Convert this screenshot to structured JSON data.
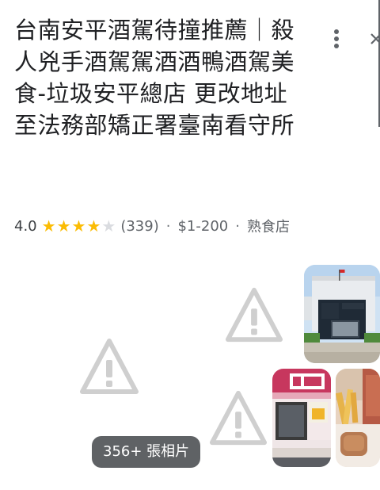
{
  "place": {
    "title": "台南安平酒駕待撞推薦｜殺人兇手酒駕駕酒酒鴨酒駕美食-垃圾安平總店 更改地址至法務部矯正署臺南看守所",
    "rating": "4.0",
    "rating_value": 4,
    "rating_max": 5,
    "review_count": "(339)",
    "separator": "·",
    "price": "$1-200",
    "category": "熟食店"
  },
  "photos": {
    "count_label": "356+ 張相片",
    "placeholder_icon": "broken-image-warning-icon",
    "thumbs": [
      "building-photo",
      "storefront-photo",
      "food-photo"
    ]
  },
  "colors": {
    "star_on": "#fbbc04",
    "star_off": "#dadce0",
    "placeholder": "#cfcfcf"
  },
  "icons": {
    "more": "more-vert-icon",
    "close": "close-icon"
  }
}
